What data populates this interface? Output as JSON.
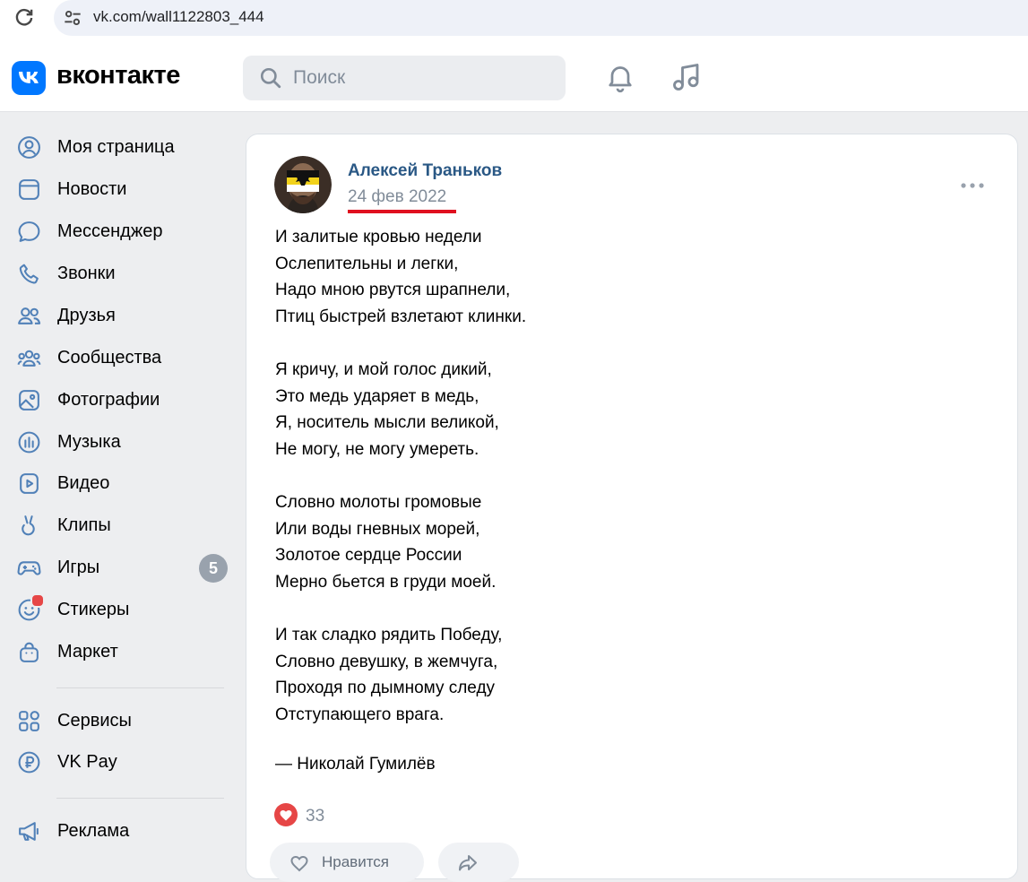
{
  "browser": {
    "url": "vk.com/wall1122803_444"
  },
  "header": {
    "logo_text": "вконтакте",
    "search_placeholder": "Поиск"
  },
  "sidebar": {
    "items": [
      {
        "label": "Моя страница",
        "icon": "user-circle-icon"
      },
      {
        "label": "Новости",
        "icon": "newsfeed-icon"
      },
      {
        "label": "Мессенджер",
        "icon": "message-icon"
      },
      {
        "label": "Звонки",
        "icon": "phone-icon"
      },
      {
        "label": "Друзья",
        "icon": "friends-icon"
      },
      {
        "label": "Сообщества",
        "icon": "communities-icon"
      },
      {
        "label": "Фотографии",
        "icon": "photo-icon"
      },
      {
        "label": "Музыка",
        "icon": "music-icon"
      },
      {
        "label": "Видео",
        "icon": "video-icon"
      },
      {
        "label": "Клипы",
        "icon": "clips-icon"
      },
      {
        "label": "Игры",
        "icon": "gamepad-icon",
        "badge": "5"
      },
      {
        "label": "Стикеры",
        "icon": "sticker-icon",
        "has_dot": true
      },
      {
        "label": "Маркет",
        "icon": "market-icon"
      },
      {
        "label": "Сервисы",
        "icon": "services-icon"
      },
      {
        "label": "VK Pay",
        "icon": "vkpay-icon"
      },
      {
        "label": "Реклама",
        "icon": "megaphone-icon"
      }
    ]
  },
  "post": {
    "author": "Алексей Траньков",
    "date": "24 фев 2022",
    "stanzas": [
      [
        "И залитые кровью недели",
        "Ослепительны и легки,",
        "Надо мною рвутся шрапнели,",
        "Птиц быстрей взлетают клинки."
      ],
      [
        "Я кричу, и мой голос дикий,",
        "Это медь ударяет в медь,",
        "Я, носитель мысли великой,",
        "Не могу, не могу умереть."
      ],
      [
        "Словно молоты громовые",
        "Или воды гневных морей,",
        "Золотое сердце России",
        "Мерно бьется в груди моей."
      ],
      [
        "И так сладко рядить Победу,",
        "Словно девушку, в жемчуга,",
        "Проходя по дымному следу",
        "Отступающего врага."
      ]
    ],
    "signature": "— Николай Гумилёв",
    "likes_count": "33",
    "actions": [
      {
        "label": "Нравится",
        "icon": "heart-outline-icon"
      },
      {
        "label": "",
        "icon": "share-icon"
      }
    ]
  },
  "colors": {
    "accent": "#0077ff",
    "link": "#2a5885",
    "secondary_text": "#818c99",
    "date_underline": "#e0101f",
    "like": "#e64646",
    "background": "#edeef0"
  }
}
